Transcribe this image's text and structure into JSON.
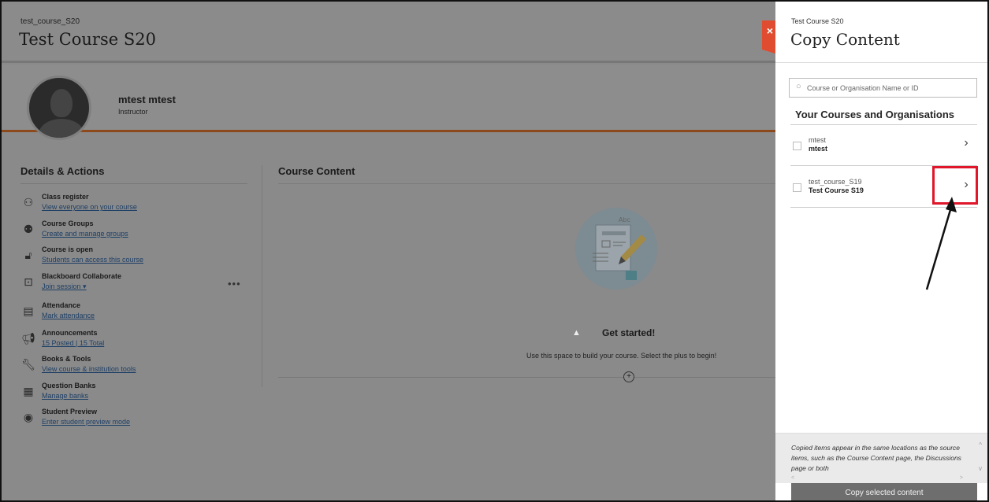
{
  "course_page": {
    "course_id": "test_course_S20",
    "course_title": "Test Course S20",
    "user_name": "mtest mtest",
    "user_role": "Instructor",
    "details_title": "Details & Actions",
    "actions": [
      {
        "icon": "class-register-icon",
        "title": "Class register",
        "link": "View everyone on your course"
      },
      {
        "icon": "groups-icon",
        "title": "Course Groups",
        "link": "Create and manage groups"
      },
      {
        "icon": "unlock-icon",
        "title": "Course is open",
        "link": "Students can access this course"
      },
      {
        "icon": "collaborate-icon",
        "title": "Blackboard Collaborate",
        "link": "Join session ▾"
      },
      {
        "icon": "attendance-icon",
        "title": "Attendance",
        "link": "Mark attendance"
      },
      {
        "icon": "megaphone-icon",
        "title": "Announcements",
        "link": "15 Posted | 15 Total"
      },
      {
        "icon": "wrench-icon",
        "title": "Books & Tools",
        "link": "View course & institution tools"
      },
      {
        "icon": "question-banks-icon",
        "title": "Question Banks",
        "link": "Manage banks"
      },
      {
        "icon": "eye-icon",
        "title": "Student Preview",
        "link": "Enter student preview mode"
      }
    ],
    "more_label": "•••",
    "content_title": "Course Content",
    "get_started": "Get started!",
    "get_started_desc": "Use this space to build your course. Select the plus to begin!",
    "add_symbol": "+"
  },
  "close_label": "×",
  "panel": {
    "subtitle": "Test Course S20",
    "title": "Copy Content",
    "search_placeholder": "Course or Organisation Name or ID",
    "list_heading": "Your Courses and Organisations",
    "courses": [
      {
        "id": "mtest",
        "name": "mtest",
        "chevron": "›"
      },
      {
        "id": "test_course_S19",
        "name": "Test Course S19",
        "chevron": "›"
      }
    ],
    "footer_note": "Copied items appear in the same locations as the source items, such as the Course Content page, the Discussions page or both",
    "copy_button": "Copy selected content"
  },
  "colors": {
    "accent_orange": "#e04c2f",
    "highlight_red": "#e0162b",
    "dim_overlay": "#8a8a8a"
  }
}
